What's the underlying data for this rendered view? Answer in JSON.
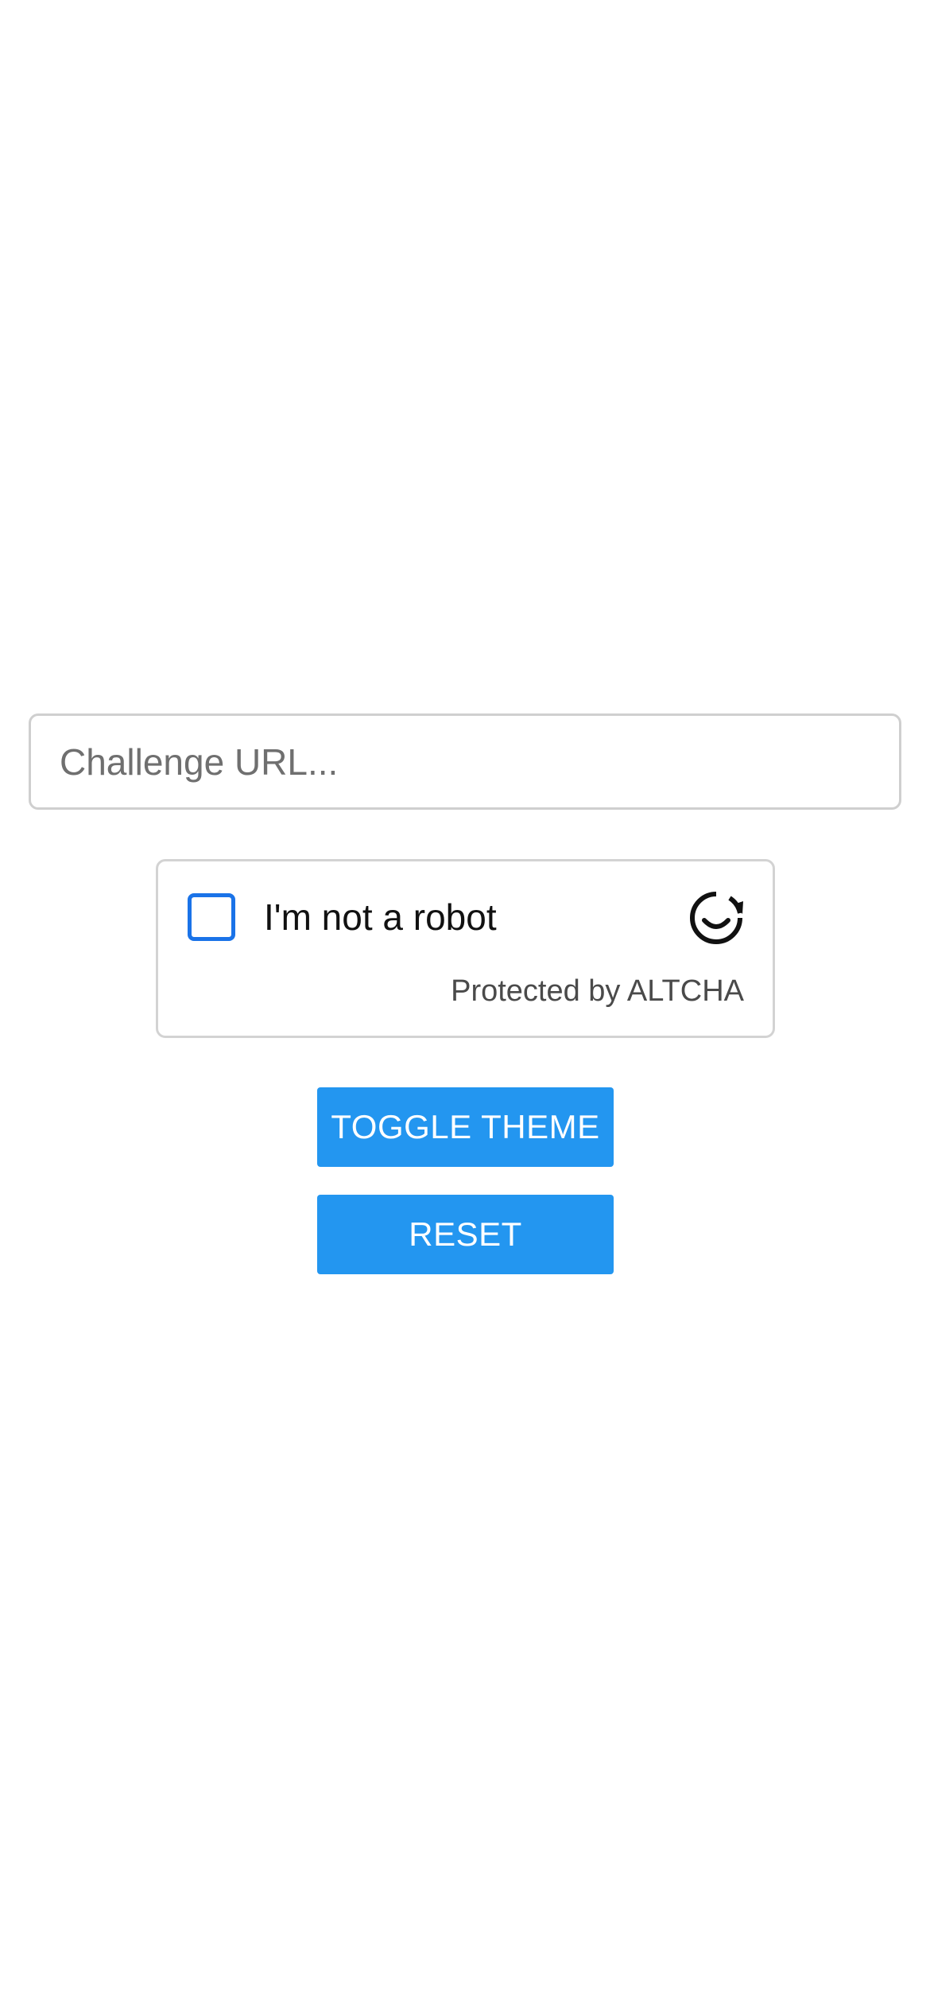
{
  "challenge_input": {
    "value": "",
    "placeholder": "Challenge URL..."
  },
  "altcha": {
    "checkbox_checked": false,
    "label": "I'm not a robot",
    "footer": "Protected by ALTCHA",
    "logo_icon": "altcha-logo-icon",
    "accent_color": "#1a73e8"
  },
  "buttons": {
    "toggle_theme_label": "TOGGLE THEME",
    "reset_label": "RESET",
    "color": "#2396f0"
  }
}
